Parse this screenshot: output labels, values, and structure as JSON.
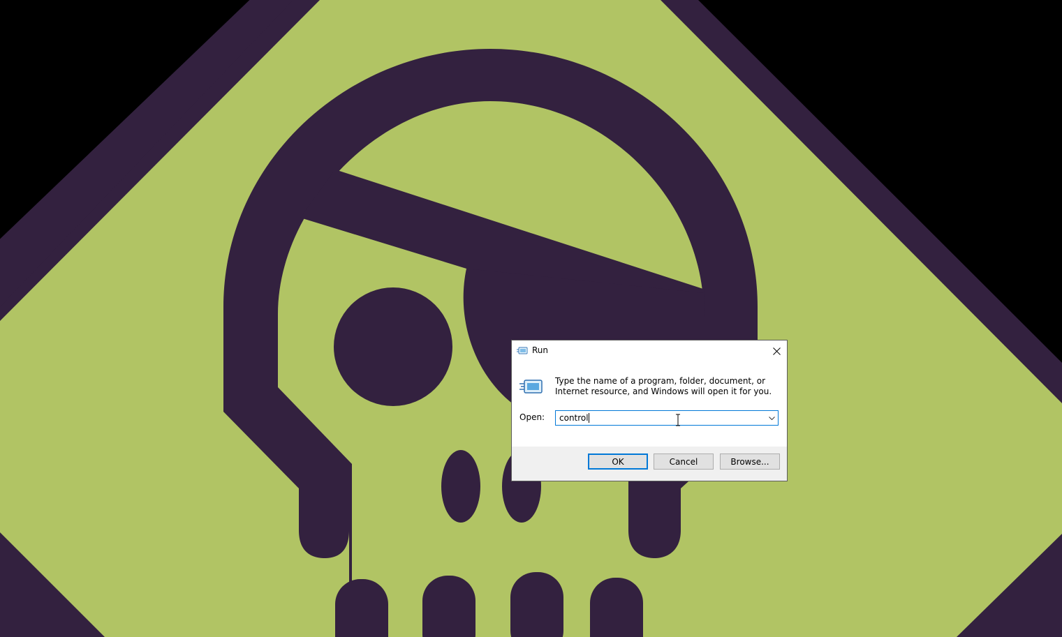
{
  "wallpaper": {
    "background_color": "#000000",
    "diamond_color": "#33213f",
    "face_color": "#b1c464",
    "icon": "pirate-skull-eyepatch"
  },
  "dialog": {
    "title": "Run",
    "title_icon": "run-icon",
    "close_icon": "close-icon",
    "description": "Type the name of a program, folder, document, or Internet resource, and Windows will open it for you.",
    "open_label": "Open:",
    "open_value": "control",
    "buttons": {
      "ok": "OK",
      "cancel": "Cancel",
      "browse": "Browse..."
    },
    "colors": {
      "focus_border": "#0078d7",
      "button_face": "#e1e1e1",
      "footer": "#f0f0f0"
    }
  }
}
